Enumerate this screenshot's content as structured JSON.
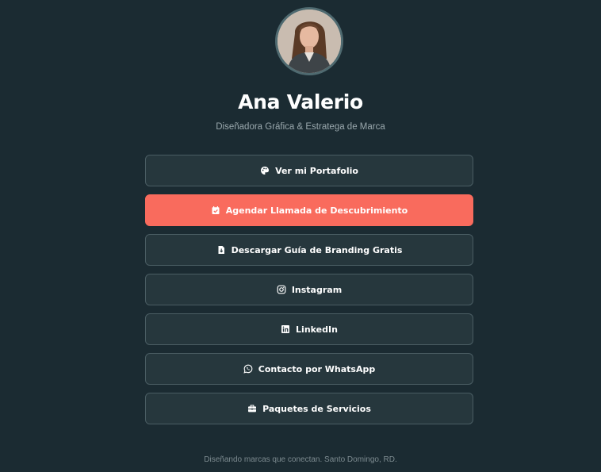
{
  "profile": {
    "name": "Ana Valerio",
    "subtitle": "Diseñadora Gráfica & Estratega de Marca"
  },
  "links": [
    {
      "label": "Ver mi Portafolio",
      "icon": "palette-icon",
      "primary": false
    },
    {
      "label": "Agendar Llamada de Descubrimiento",
      "icon": "calendar-check-icon",
      "primary": true
    },
    {
      "label": "Descargar Guía de Branding Gratis",
      "icon": "file-download-icon",
      "primary": false
    },
    {
      "label": "Instagram",
      "icon": "instagram-icon",
      "primary": false
    },
    {
      "label": "LinkedIn",
      "icon": "linkedin-icon",
      "primary": false
    },
    {
      "label": "Contacto por WhatsApp",
      "icon": "whatsapp-icon",
      "primary": false
    },
    {
      "label": "Paquetes de Servicios",
      "icon": "briefcase-icon",
      "primary": false
    }
  ],
  "footer": {
    "text": "Diseñando marcas que conectan. Santo Domingo, RD."
  },
  "colors": {
    "background": "#1b2b32",
    "button": "#26373d",
    "button_border": "#4a5d63",
    "accent": "#f96b5d",
    "text": "#ffffff",
    "muted": "#9aa8ad"
  }
}
